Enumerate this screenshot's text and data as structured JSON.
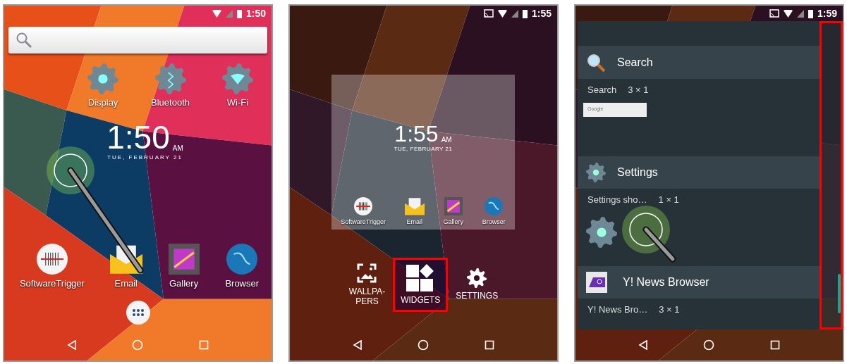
{
  "screens": [
    {
      "kind": "home",
      "status_bar": {
        "time": "1:50",
        "cast": false
      },
      "shortcuts": [
        {
          "label": "Display",
          "kind": "display"
        },
        {
          "label": "Bluetooth",
          "kind": "bluetooth"
        },
        {
          "label": "Wi-Fi",
          "kind": "wifi"
        }
      ],
      "clock": {
        "time": "1:50",
        "ampm": "AM",
        "date": "TUE, FEBRUARY 21"
      },
      "apps": [
        {
          "label": "SoftwareTrigger",
          "kind": "scanner"
        },
        {
          "label": "Email",
          "kind": "email"
        },
        {
          "label": "Gallery",
          "kind": "gallery"
        },
        {
          "label": "Browser",
          "kind": "browser"
        }
      ]
    },
    {
      "kind": "overview",
      "status_bar": {
        "time": "1:55",
        "cast": true
      },
      "clock": {
        "time": "1:55",
        "ampm": "AM",
        "date": "TUE, FEBRUARY 21"
      },
      "apps": [
        {
          "label": "SoftwareTrigger",
          "kind": "scanner"
        },
        {
          "label": "Email",
          "kind": "email"
        },
        {
          "label": "Gallery",
          "kind": "gallery"
        },
        {
          "label": "Browser",
          "kind": "browser"
        }
      ],
      "options": [
        {
          "lines": [
            "WALLPA-",
            "PERS"
          ],
          "kind": "wallpapers",
          "highlighted": false
        },
        {
          "lines": [
            "WIDGETS"
          ],
          "kind": "widgets",
          "highlighted": true
        },
        {
          "lines": [
            "SETTINGS"
          ],
          "kind": "settings",
          "highlighted": false
        }
      ]
    },
    {
      "kind": "widgets",
      "status_bar": {
        "time": "1:59",
        "cast": true
      },
      "scrollbar_highlighted": true,
      "sections": [
        {
          "title": "Search",
          "kind": "search",
          "widget": "Search",
          "size": "3 × 1",
          "preview": "Google"
        },
        {
          "title": "Settings",
          "kind": "settings",
          "widget": "Settings sho…",
          "size": "1 × 1"
        },
        {
          "title": "Y! News Browser",
          "kind": "news",
          "widget": "Y! News Bro…",
          "size": "3 × 1"
        }
      ]
    }
  ]
}
